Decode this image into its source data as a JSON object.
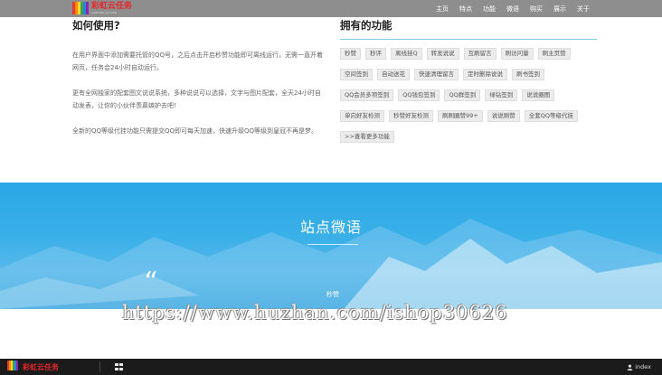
{
  "header": {
    "logo_title": "彩虹云任务",
    "logo_subtitle": "CAIHONG QQ TASK",
    "logo_colors": [
      "#e53935",
      "#fb8c00",
      "#fdd835",
      "#43a047",
      "#1e88e5",
      "#8e24aa"
    ],
    "nav": [
      "主页",
      "特点",
      "功能",
      "微语",
      "购买",
      "展示",
      "关于"
    ]
  },
  "usage": {
    "title": "如何使用?",
    "paragraphs": [
      "在用户界面中添加需要托管的QQ号，之后点击开启秒赞功能即可离线运行，无需一直开着网页，任务会24小时自动运行。",
      "更有全网独家的配套图文说说系统，多种说说可以选择，文字与图片配套，全天24小时自动发表，让你的小伙伴羡慕嫉妒去吧!",
      "全新的QQ等级代挂功能只需提交QQ即可每天加速，快速升级QQ等级到皇冠不再是梦。"
    ]
  },
  "features": {
    "title": "拥有的功能",
    "tags": [
      "秒赞",
      "秒评",
      "离线挂Q",
      "转发说说",
      "互刷留言",
      "刷访问量",
      "刷主页赞",
      "空间签到",
      "自动送花",
      "快速清理留言",
      "定时删除说说",
      "刷书签到",
      "QQ会员多项签到",
      "QQ钱包签到",
      "QQ群签到",
      "绿钻签到",
      "说说圈图",
      "单向好友检测",
      "秒赞好友检测",
      "刷刷圈赞99+",
      "说说刷赞",
      "全套QQ等级代挂",
      ">>查看更多功能"
    ]
  },
  "band": {
    "title": "站点微语",
    "quote_mark": "“",
    "user": "秒赞"
  },
  "watermark": "https://www.huzhan.com/ishop30626",
  "taskbar": {
    "title": "彩虹云任务",
    "user_label": "index"
  },
  "colors": {
    "accent_line": "#7fd0e3",
    "band_blue": "#29a8e6",
    "logo_red": "#e8262b"
  }
}
